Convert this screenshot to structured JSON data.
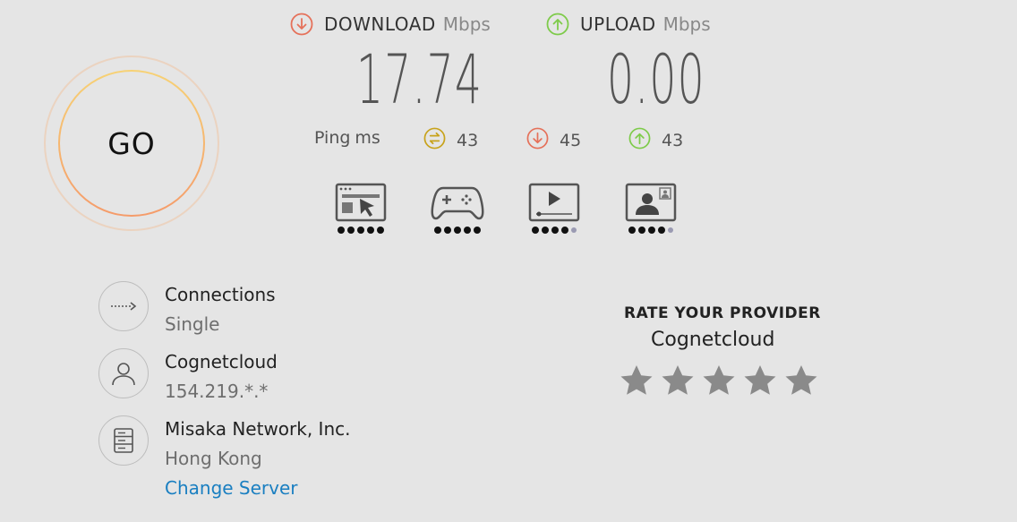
{
  "go": {
    "label": "GO"
  },
  "download": {
    "label": "DOWNLOAD",
    "unit": "Mbps",
    "value": "17.74",
    "icon": "arrow-down-circle-icon",
    "color": "#e5715a"
  },
  "upload": {
    "label": "UPLOAD",
    "unit": "Mbps",
    "value": "0.00",
    "icon": "arrow-up-circle-icon",
    "color": "#7ecb4a"
  },
  "ping": {
    "label": "Ping",
    "unit": "ms",
    "idle": {
      "value": "43",
      "icon": "ping-idle-icon",
      "color": "#c8a31c"
    },
    "download": {
      "value": "45",
      "icon": "arrow-down-circle-icon",
      "color": "#e5715a"
    },
    "upload": {
      "value": "43",
      "icon": "arrow-up-circle-icon",
      "color": "#7ecb4a"
    }
  },
  "experience": [
    {
      "name": "web-browsing",
      "icon": "browser-cursor-icon",
      "rating": 5,
      "max": 5
    },
    {
      "name": "gaming",
      "icon": "gamepad-icon",
      "rating": 5,
      "max": 5
    },
    {
      "name": "streaming",
      "icon": "video-player-icon",
      "rating": 4,
      "max": 5
    },
    {
      "name": "video-chat",
      "icon": "video-call-icon",
      "rating": 4,
      "max": 5
    }
  ],
  "connections": {
    "title": "Connections",
    "value": "Single",
    "icon": "dotted-arrow-icon"
  },
  "provider": {
    "title": "Cognetcloud",
    "ip": "154.219.*.*",
    "icon": "user-icon"
  },
  "server": {
    "title": "Misaka Network, Inc.",
    "location": "Hong Kong",
    "change_label": "Change Server",
    "icon": "server-icon"
  },
  "rating": {
    "title": "RATE YOUR PROVIDER",
    "provider": "Cognetcloud",
    "stars": 5,
    "star_color": "#8a8a8a"
  }
}
